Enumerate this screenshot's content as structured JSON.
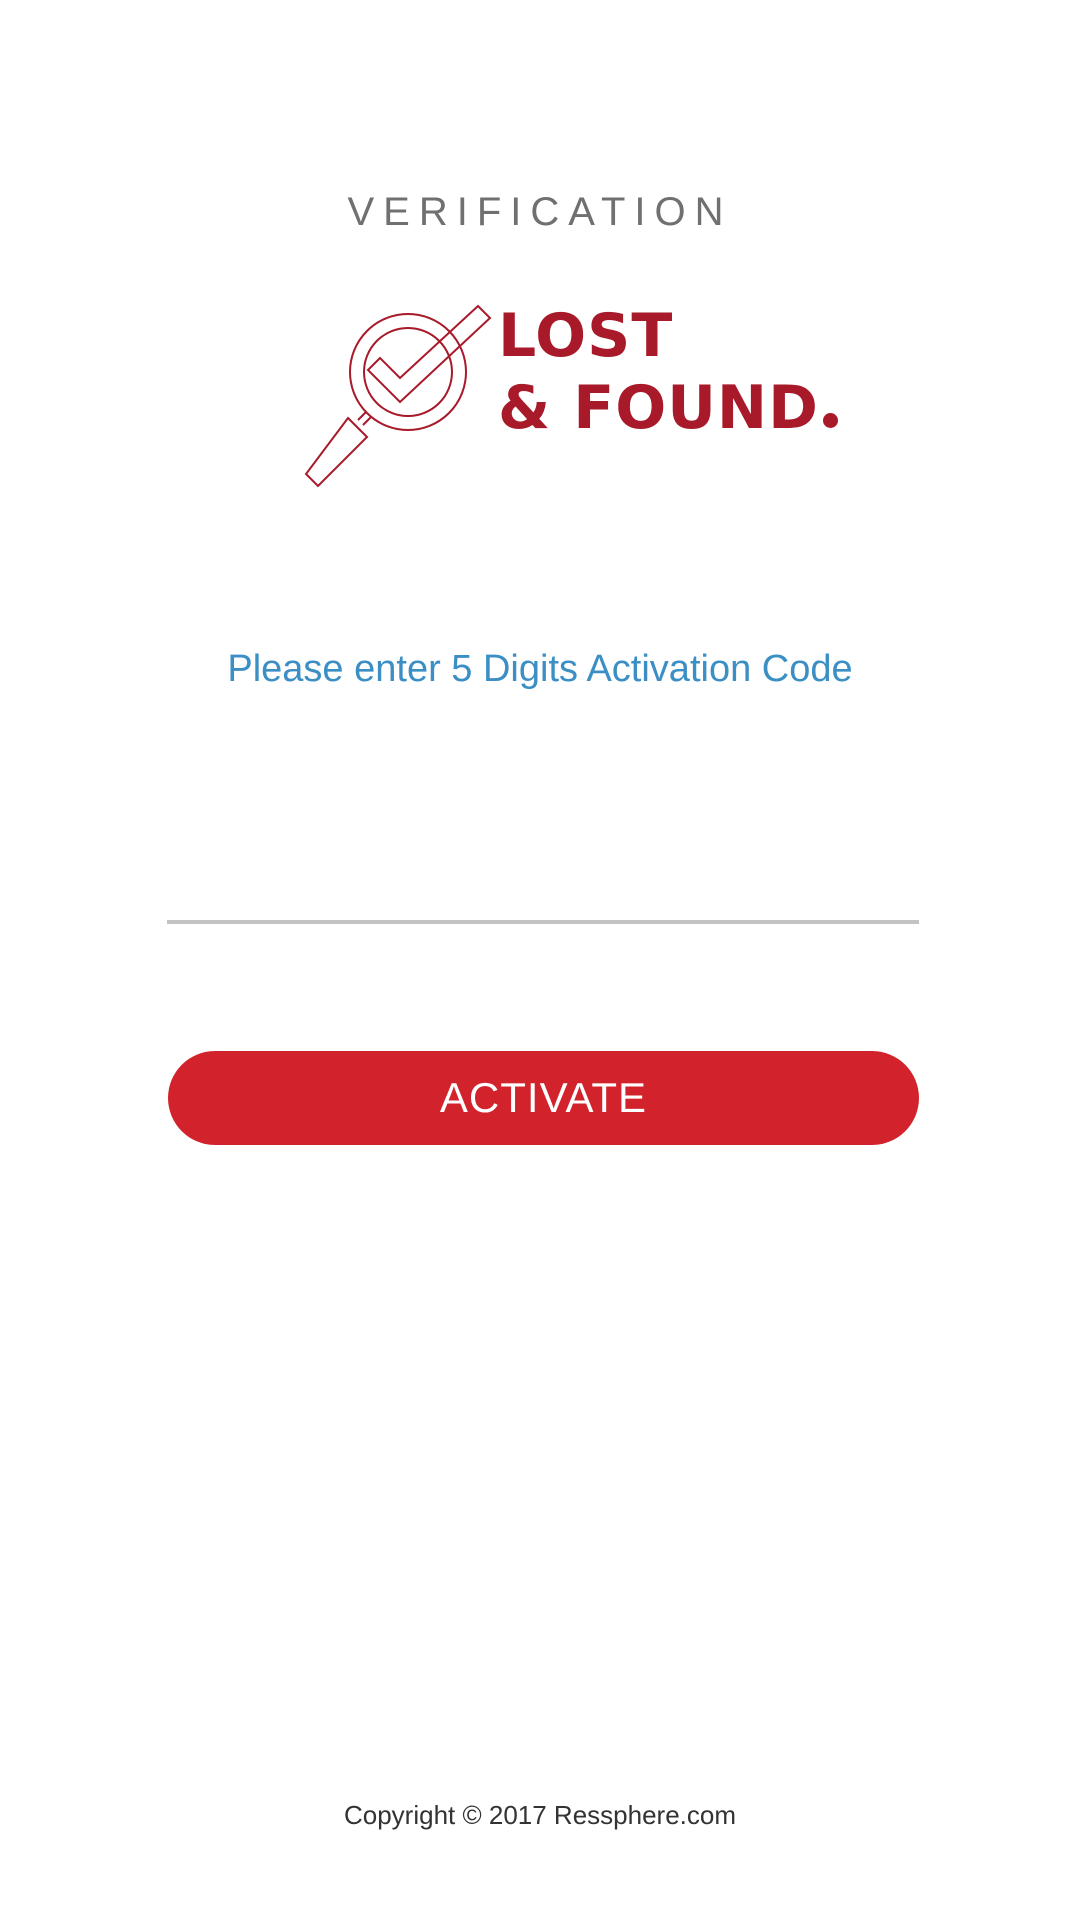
{
  "header": {
    "title": "VERIFICATION"
  },
  "logo": {
    "line1": "LOST",
    "line2": "& FOUND",
    "icon": "magnifier-check-icon",
    "color": "#a8192a"
  },
  "form": {
    "prompt": "Please enter 5 Digits Activation Code",
    "code_value": "",
    "activate_label": "ACTIVATE",
    "button_color": "#d2232c",
    "prompt_color": "#3b8fc4"
  },
  "footer": {
    "copyright": "Copyright © 2017 Ressphere.com"
  }
}
